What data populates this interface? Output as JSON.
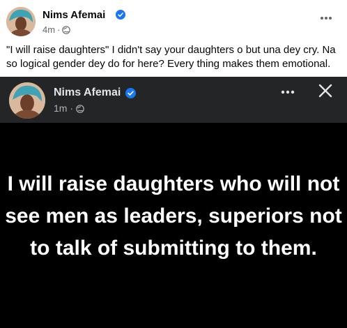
{
  "post": {
    "author": "Nims Afemai",
    "time": "4m",
    "separator": "·",
    "text": "\"I will raise daughters\" I didn't say your daughters o but una dey cry. Na so logical gender dey do for here? Every thing makes them emotional."
  },
  "story": {
    "author": "Nims Afemai",
    "time": "1m",
    "separator": "·",
    "text": "I will raise daughters who will not see men as leaders, superiors not to talk of submitting to them."
  },
  "icons": {
    "verified": "verified-badge-icon",
    "privacy": "globe-icon",
    "more": "more-options-icon",
    "close": "close-icon"
  },
  "colors": {
    "verified_blue": "#1877f2",
    "story_bar": "#242526",
    "story_bg": "#000000",
    "meta_gray": "#65676b"
  }
}
